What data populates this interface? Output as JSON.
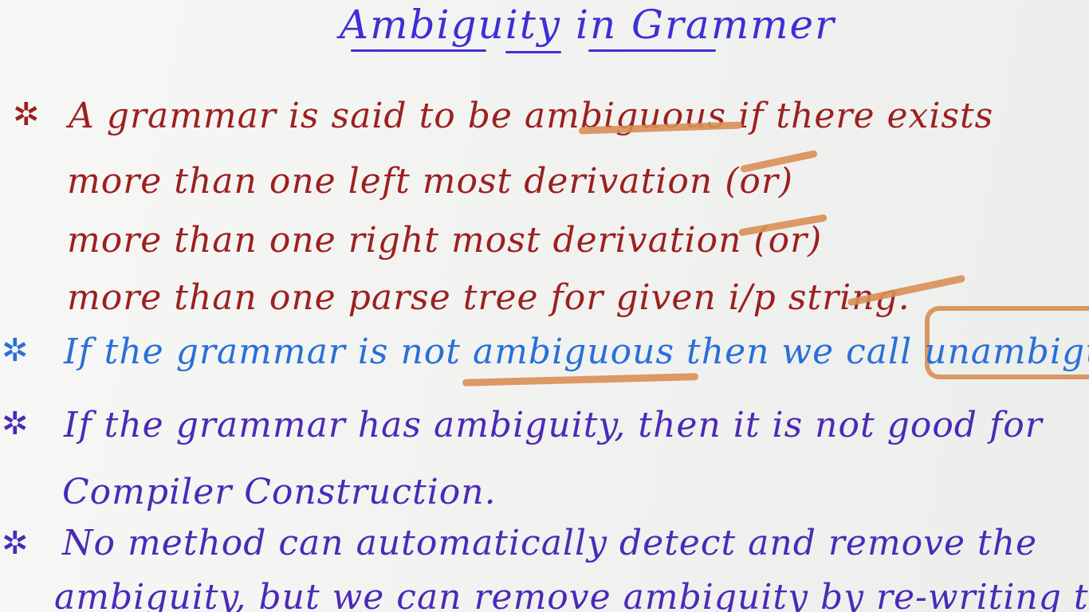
{
  "title": "Ambiguity in Grammer",
  "points": [
    {
      "bullet": "✲",
      "color": "#9c2020",
      "lines": [
        "A grammar is said to be ambiguous if there exists",
        "more than one left most derivation (or)",
        "more than one right most derivation (or)",
        "more than one parse tree for given i/p string."
      ]
    },
    {
      "bullet": "✲",
      "color": "#2a6fd8",
      "lines": [
        "If the grammar is not ambiguous then we call unambigu"
      ]
    },
    {
      "bullet": "✲",
      "color": "#4a2ab8",
      "lines": [
        "If the grammar has ambiguity, then it is not good for",
        "Compiler Construction."
      ]
    },
    {
      "bullet": "✲",
      "color": "#4a2ab8",
      "lines": [
        "No method can automatically detect and remove the",
        "ambiguity, but we can remove ambiguity by re-writing the"
      ]
    }
  ],
  "highlight_color": "#d98e55"
}
